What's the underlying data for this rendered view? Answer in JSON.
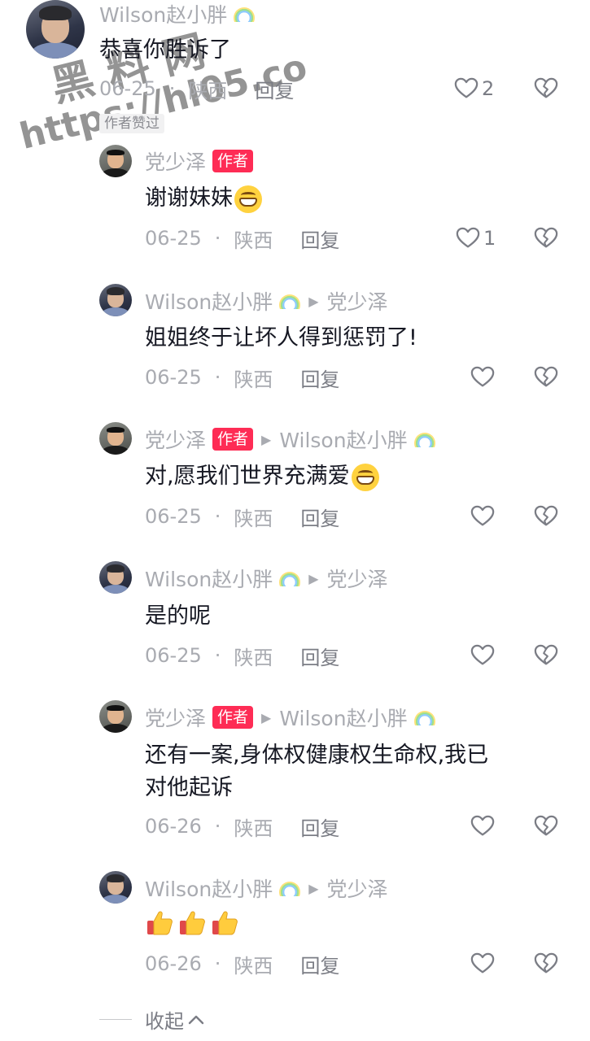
{
  "root_comment": {
    "user": "Wilson赵小胖",
    "text": "恭喜你胜诉了",
    "date": "06-25",
    "location": "陕西",
    "reply_label": "回复",
    "likes": "2",
    "liked_by_author": "作者赞过"
  },
  "replies": [
    {
      "user": "党少泽",
      "author_tag": "作者",
      "reply_to": "",
      "text": "谢谢妹妹",
      "date": "06-25",
      "location": "陕西",
      "reply_label": "回复",
      "likes": "1"
    },
    {
      "user": "Wilson赵小胖",
      "author_tag": "",
      "reply_to": "党少泽",
      "text": "姐姐终于让坏人得到惩罚了!",
      "date": "06-25",
      "location": "陕西",
      "reply_label": "回复",
      "likes": ""
    },
    {
      "user": "党少泽",
      "author_tag": "作者",
      "reply_to": "Wilson赵小胖",
      "text": "对,愿我们世界充满爱",
      "date": "06-25",
      "location": "陕西",
      "reply_label": "回复",
      "likes": ""
    },
    {
      "user": "Wilson赵小胖",
      "author_tag": "",
      "reply_to": "党少泽",
      "text": "是的呢",
      "date": "06-25",
      "location": "陕西",
      "reply_label": "回复",
      "likes": ""
    },
    {
      "user": "党少泽",
      "author_tag": "作者",
      "reply_to": "Wilson赵小胖",
      "text_line1": "还有一案,身体权健康权生命权,我已",
      "text_line2": "对他起诉",
      "date": "06-26",
      "location": "陕西",
      "reply_label": "回复",
      "likes": ""
    },
    {
      "user": "Wilson赵小胖",
      "author_tag": "",
      "reply_to": "党少泽",
      "text": "",
      "date": "06-26",
      "location": "陕西",
      "reply_label": "回复",
      "likes": ""
    }
  ],
  "separator": "·",
  "collapse_label": "收起",
  "watermark": {
    "line1": "黑料网",
    "line2": "https://hl05.co"
  },
  "icons": [
    "heart-outline-icon",
    "heart-broken-icon",
    "rainbow-emoji-icon",
    "grinning-emoji-icon",
    "thumbs-up-emoji-icon",
    "chevron-up-icon",
    "reply-arrow-icon"
  ],
  "colors": {
    "author_tag": "#fe2c55",
    "username": "#a9abb1",
    "text": "#161823",
    "meta": "#a9abb1"
  }
}
